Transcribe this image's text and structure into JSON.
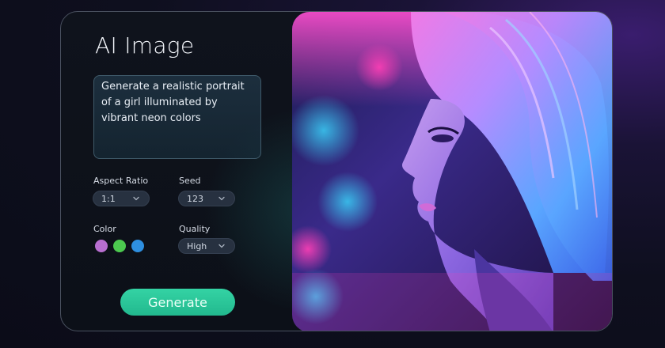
{
  "app": {
    "title": "AI Image"
  },
  "prompt": {
    "value": "Generate a realistic portrait of a girl illuminated by vibrant neon colors"
  },
  "settings": {
    "aspect_ratio": {
      "label": "Aspect Ratio",
      "value": "1:1"
    },
    "seed": {
      "label": "Seed",
      "value": "123"
    },
    "color": {
      "label": "Color",
      "swatches": [
        "#b86fd0",
        "#4cc94f",
        "#2e8fe0"
      ]
    },
    "quality": {
      "label": "Quality",
      "value": "High"
    }
  },
  "actions": {
    "generate_label": "Generate"
  },
  "colors": {
    "accent": "#2cc79a",
    "card_border": "#4a5160",
    "background": "#0e0f1e"
  },
  "preview": {
    "icon": "neon-portrait-image"
  }
}
